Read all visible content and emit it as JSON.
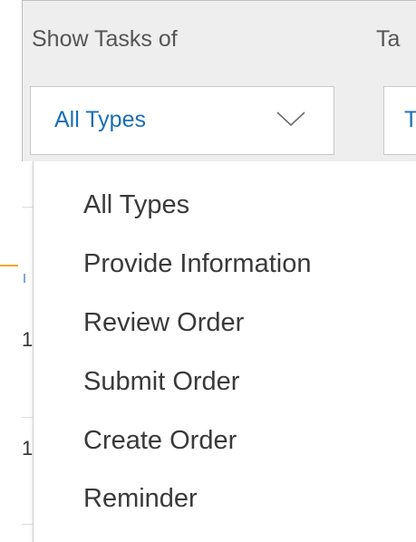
{
  "filters": {
    "show_tasks_label": "Show Tasks of",
    "second_label": "Ta",
    "type_select_value": "All Types",
    "second_select_value": "T"
  },
  "dropdown": {
    "items": [
      "All Types",
      "Provide Information",
      "Review Order",
      "Submit Order",
      "Create Order",
      "Reminder"
    ]
  },
  "background_rows": {
    "fragments": [
      "1",
      "1"
    ]
  },
  "colors": {
    "accent_blue": "#1a6fb5",
    "panel_gray": "#eeeeee",
    "orange_marker": "#f5a623"
  }
}
